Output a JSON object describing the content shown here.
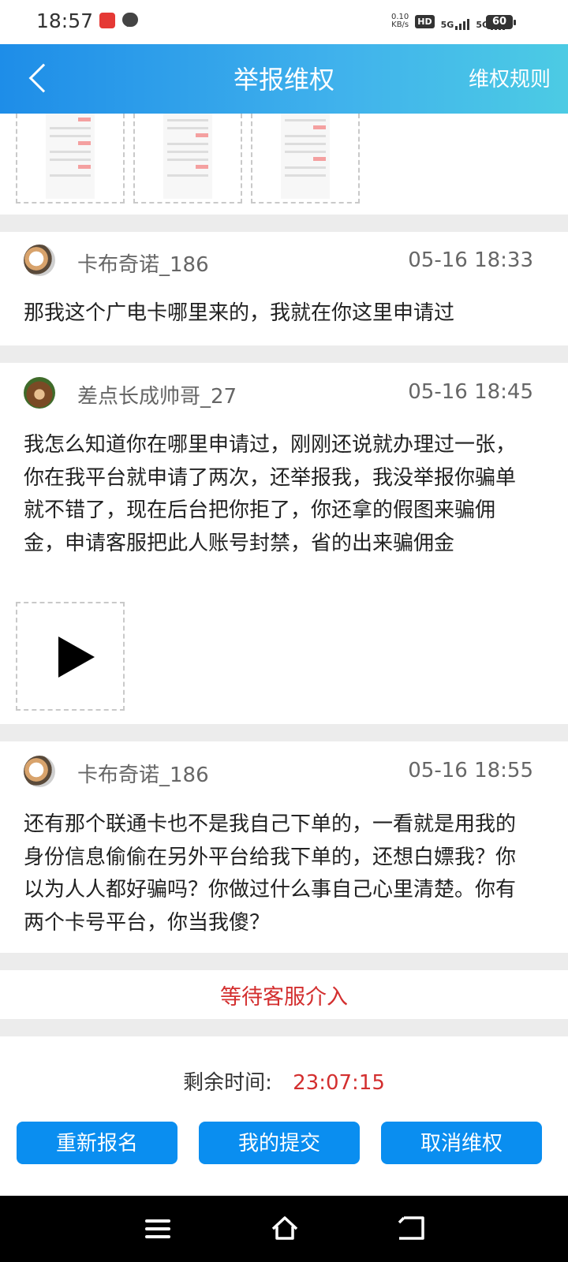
{
  "status_bar": {
    "time": "18:57",
    "net_speed_value": "0.10",
    "net_speed_unit": "KB/s",
    "hd": "HD",
    "sim1_gen": "5G",
    "sim2_gen": "5G",
    "battery": "60"
  },
  "header": {
    "title": "举报维权",
    "rules_link": "维权规则"
  },
  "comments": [
    {
      "user": "卡布奇诺_186",
      "time": "05-16 18:33",
      "text": "那我这个广电卡哪里来的，我就在你这里申请过"
    },
    {
      "user": "差点长成帅哥_27",
      "time": "05-16 18:45",
      "text": "我怎么知道你在哪里申请过，刚刚还说就办理过一张，你在我平台就申请了两次，还举报我，我没举报你骗单就不错了，现在后台把你拒了，你还拿的假图来骗佣金，申请客服把此人账号封禁，省的出来骗佣金"
    },
    {
      "user": "卡布奇诺_186",
      "time": "05-16 18:55",
      "text": "还有那个联通卡也不是我自己下单的，一看就是用我的身份信息偷偷在另外平台给我下单的，还想白嫖我？你以为人人都好骗吗？你做过什么事自己心里清楚。你有两个卡号平台，你当我傻？"
    }
  ],
  "status": "等待客服介入",
  "remaining": {
    "label": "剩余时间:",
    "value": "23:07:15"
  },
  "buttons": {
    "re_register": "重新报名",
    "my_submission": "我的提交",
    "cancel_claim": "取消维权"
  },
  "colors": {
    "header_gradient_start": "#1e8de8",
    "header_gradient_end": "#4ccbe4",
    "button_blue": "#0a8ef0",
    "alert_red": "#d32f2f"
  }
}
